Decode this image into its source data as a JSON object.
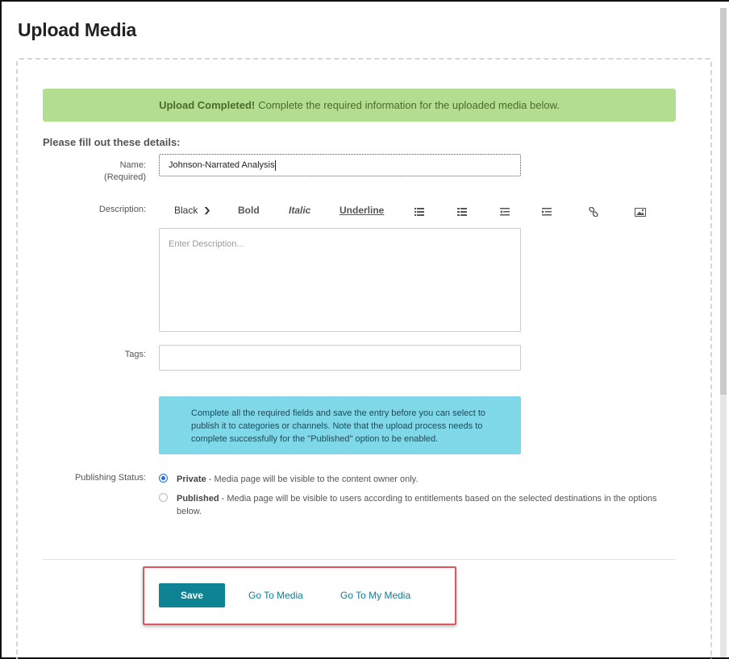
{
  "page": {
    "title": "Upload Media"
  },
  "alert": {
    "strong": "Upload Completed!",
    "text": "Complete the required information for the uploaded media below."
  },
  "form": {
    "heading": "Please fill out these details:",
    "name": {
      "label": "Name:",
      "sublabel": "(Required)",
      "value": "Johnson-Narrated Analysis"
    },
    "description": {
      "label": "Description:",
      "placeholder": "Enter Description..."
    },
    "toolbar": {
      "color": "Black",
      "bold": "Bold",
      "italic": "Italic",
      "underline": "Underline",
      "icons": [
        "unordered-list-icon",
        "ordered-list-icon",
        "outdent-icon",
        "indent-icon",
        "link-icon",
        "image-icon"
      ]
    },
    "tags": {
      "label": "Tags:"
    },
    "info": "Complete all the required fields and save the entry before you can select to publish it to categories or channels. Note that the upload process needs to complete successfully for the \"Published\" option to be enabled.",
    "publishing": {
      "label": "Publishing Status:",
      "options": [
        {
          "title": "Private",
          "desc": " - Media page will be visible to the content owner only.",
          "checked": true
        },
        {
          "title": "Published",
          "desc": " - Media page will be visible to users according to entitlements based on the selected destinations in the options below.",
          "checked": false
        }
      ]
    }
  },
  "actions": {
    "save": "Save",
    "go_to_media": "Go To Media",
    "go_to_my_media": "Go To My Media"
  },
  "colors": {
    "save_button": "#0e8394",
    "success_bg": "#b4de8f",
    "info_bg": "#7fd8e8",
    "highlight": "#e0565b",
    "link": "#0e7d95"
  }
}
